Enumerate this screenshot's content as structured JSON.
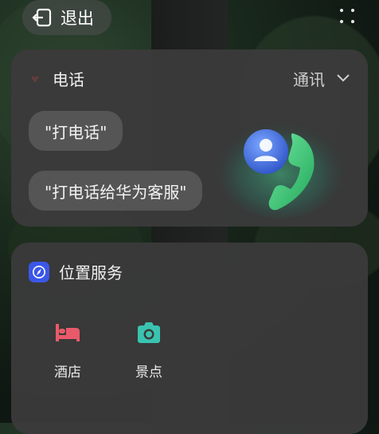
{
  "top_bar": {
    "exit_label": "退出",
    "exit_icon": "exit-icon",
    "menu_icon": "grid-dots-icon"
  },
  "phone_card": {
    "title": "电话",
    "category_label": "通讯",
    "suggestions": [
      "\"打电话\"",
      "\"打电话给华为客服\""
    ],
    "illustration_icon": "phone-contact-icon"
  },
  "location_card": {
    "title": "位置服务",
    "services": [
      {
        "label": "酒店",
        "icon": "bed-icon"
      },
      {
        "label": "景点",
        "icon": "camera-icon"
      }
    ]
  },
  "colors": {
    "card_bg": "#3a3a3a",
    "chip_bg": "#555555",
    "accent_blue": "#3b57e8",
    "hotel_red": "#e85a6a",
    "camera_teal": "#39c4b0",
    "phone_green": "#2fbf6a"
  }
}
